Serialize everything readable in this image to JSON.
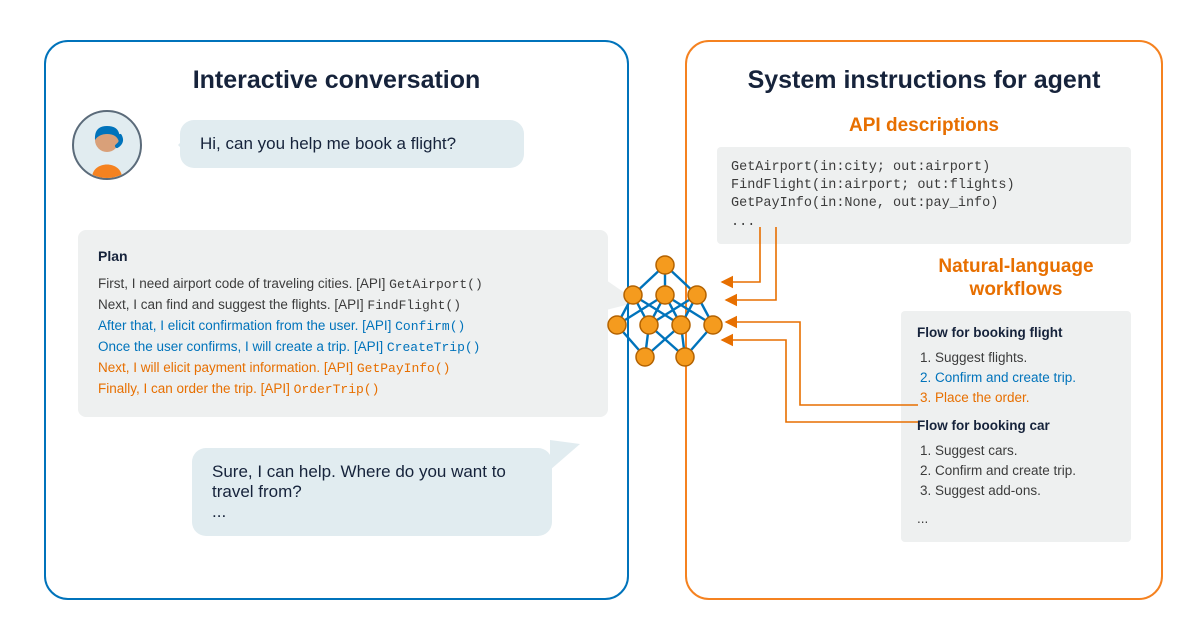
{
  "left": {
    "title": "Interactive conversation",
    "user_msg": "Hi, can you help me book a flight?",
    "plan": {
      "heading": "Plan",
      "lines": [
        {
          "color": "default",
          "text": "First, I need airport code of traveling cities. [API] ",
          "api": "GetAirport()"
        },
        {
          "color": "default",
          "text": "Next, I can find and suggest the flights. [API] ",
          "api": "FindFlight()"
        },
        {
          "color": "blue",
          "text": "After that, I elicit confirmation from the user. [API] ",
          "api": "Confirm()"
        },
        {
          "color": "blue",
          "text": "Once the user confirms, I will create a trip. [API] ",
          "api": "CreateTrip()"
        },
        {
          "color": "orange",
          "text": "Next, I will elicit payment information. [API] ",
          "api": "GetPayInfo()"
        },
        {
          "color": "orange",
          "text": "Finally, I can order the trip. [API] ",
          "api": "OrderTrip()"
        }
      ]
    },
    "agent_msg_line1": "Sure, I can help. Where do you want to travel from?",
    "agent_msg_line2": "..."
  },
  "right": {
    "title": "System instructions for agent",
    "api_subtitle": "API descriptions",
    "api_code": "GetAirport(in:city; out:airport)\nFindFlight(in:airport; out:flights)\nGetPayInfo(in:None, out:pay_info)\n...",
    "workflows_subtitle": "Natural-language workflows",
    "flow_flight_title": "Flow for booking flight",
    "flow_flight_steps": [
      {
        "color": "default",
        "text": "Suggest flights."
      },
      {
        "color": "blue",
        "text": "Confirm and create trip."
      },
      {
        "color": "orange",
        "text": "Place the order."
      }
    ],
    "flow_car_title": "Flow for booking car",
    "flow_car_steps": [
      {
        "color": "default",
        "text": "Suggest cars."
      },
      {
        "color": "default",
        "text": "Confirm and create trip."
      },
      {
        "color": "default",
        "text": "Suggest add-ons."
      }
    ],
    "flow_car_trailing": "..."
  },
  "colors": {
    "blue": "#0073bb",
    "orange": "#f58220",
    "orange_text": "#e76f00",
    "bubble": "#e1ecf0",
    "box": "#eef0f0",
    "text": "#16233b"
  }
}
